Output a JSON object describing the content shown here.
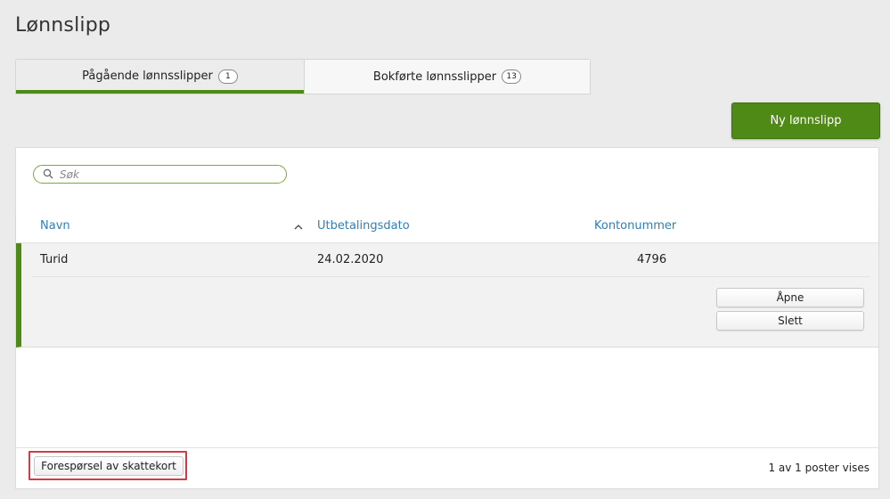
{
  "page": {
    "title": "Lønnslipp"
  },
  "tabs": [
    {
      "label": "Pågående lønnsslipper",
      "badge": "1",
      "active": true
    },
    {
      "label": "Bokførte lønnsslipper",
      "badge": "13",
      "active": false
    }
  ],
  "actions": {
    "new_label": "Ny lønnslipp"
  },
  "search": {
    "placeholder": "Søk",
    "value": ""
  },
  "table": {
    "columns": [
      "Navn",
      "Utbetalingsdato",
      "Kontonummer"
    ],
    "sort_column": "Navn",
    "rows": [
      {
        "name": "Turid",
        "date": "24.02.2020",
        "account": "4796"
      }
    ],
    "row_actions": {
      "open_label": "Åpne",
      "delete_label": "Slett"
    }
  },
  "footer": {
    "tax_card_label": "Forespørsel av skattekort",
    "count_text": "1 av 1 poster vises"
  },
  "colors": {
    "accent": "#4d8b16",
    "link": "#2f7fb8",
    "highlight": "#d43b47"
  },
  "icons": {
    "search": "search-icon",
    "sort": "sort-ascending-icon"
  }
}
